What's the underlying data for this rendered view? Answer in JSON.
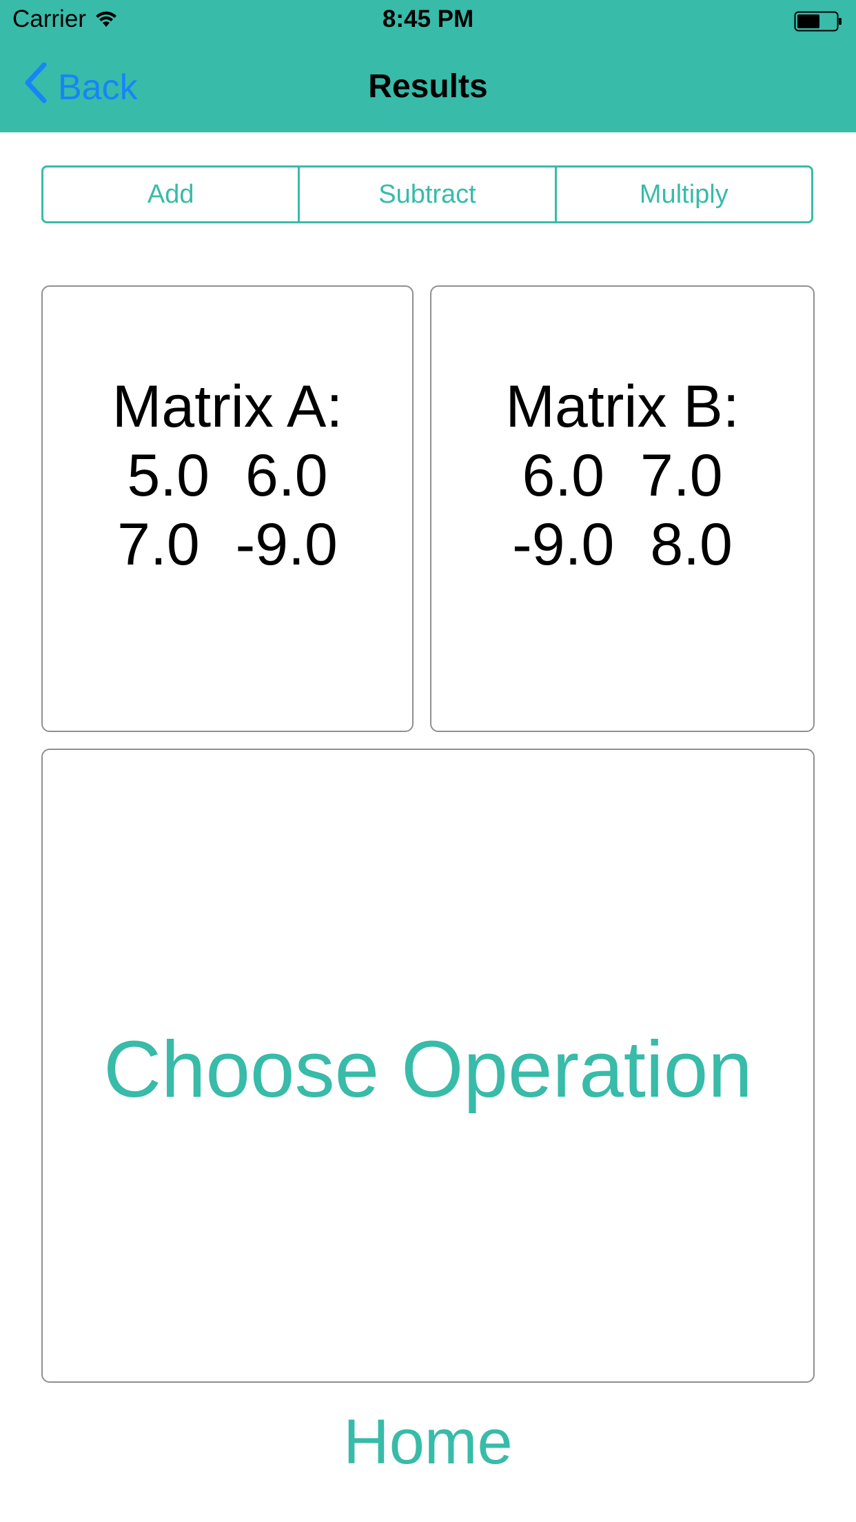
{
  "status_bar": {
    "carrier": "Carrier",
    "time": "8:45 PM"
  },
  "nav": {
    "back_label": "Back",
    "title": "Results"
  },
  "segments": [
    "Add",
    "Subtract",
    "Multiply"
  ],
  "matrix_a": {
    "title": "Matrix A:",
    "rows": [
      [
        "5.0",
        "6.0"
      ],
      [
        "7.0",
        "-9.0"
      ]
    ]
  },
  "matrix_b": {
    "title": "Matrix B:",
    "rows": [
      [
        "6.0",
        "7.0"
      ],
      [
        "-9.0",
        "8.0"
      ]
    ]
  },
  "result": {
    "text": "Choose Operation"
  },
  "home_label": "Home",
  "colors": {
    "accent": "#38bba9",
    "link_blue": "#1685f7",
    "border_gray": "#8f8f8f"
  },
  "icons": {
    "wifi": "wifi-icon",
    "battery": "battery-icon",
    "back": "chevron-left-icon"
  }
}
